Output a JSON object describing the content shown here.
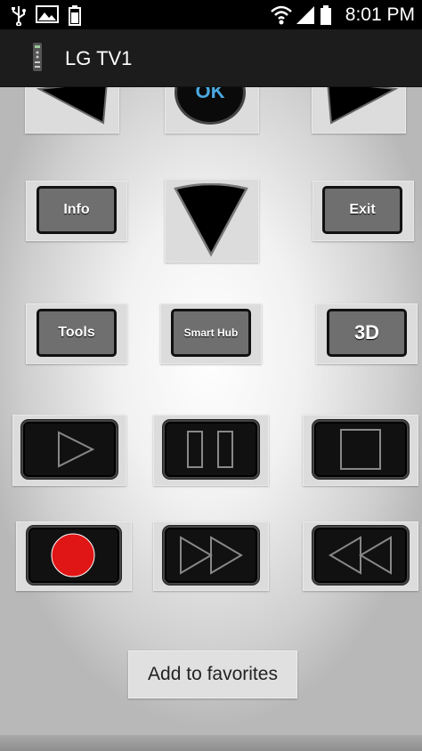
{
  "status_bar": {
    "time": "8:01 PM",
    "icons": [
      "usb-icon",
      "image-icon",
      "battery-small-icon",
      "wifi-icon",
      "signal-icon",
      "battery-icon"
    ]
  },
  "action_bar": {
    "title": "LG TV1",
    "app_icon": "remote-icon"
  },
  "remote": {
    "ok_label": "OK",
    "info_label": "Info",
    "exit_label": "Exit",
    "tools_label": "Tools",
    "smart_hub_label": "Smart Hub",
    "three_d_label": "3D",
    "media_buttons": [
      "play-icon",
      "pause-icon",
      "stop-icon",
      "record-icon",
      "fast-forward-icon",
      "rewind-icon"
    ],
    "record_color": "#e01515"
  },
  "favorites": {
    "add_label": "Add to favorites"
  }
}
